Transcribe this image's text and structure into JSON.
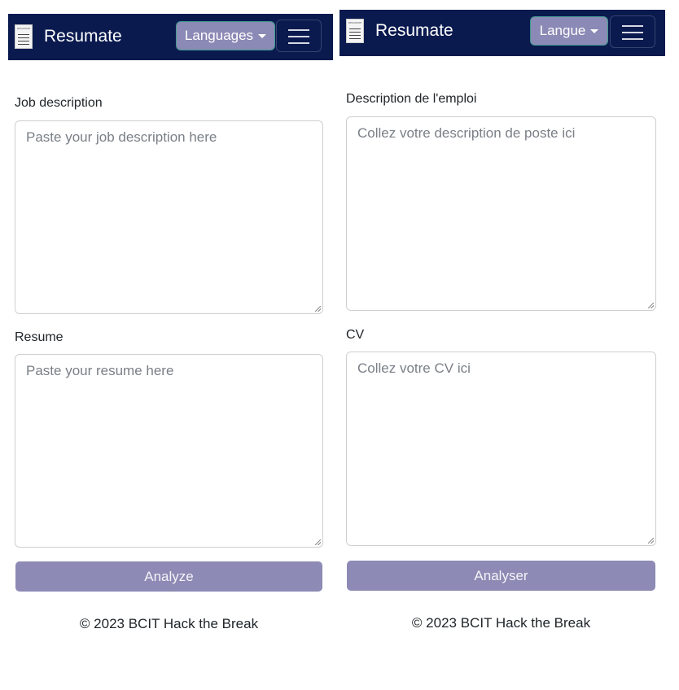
{
  "left": {
    "brand": "Resumate",
    "logo_text": "RESUMATE",
    "language_button": "Languages",
    "job_label": "Job description",
    "job_placeholder": "Paste your job description here",
    "resume_label": "Resume",
    "resume_placeholder": "Paste your resume here",
    "analyze_button": "Analyze",
    "footer": "© 2023 BCIT Hack the Break"
  },
  "right": {
    "brand": "Resumate",
    "logo_text": "RESUMATE",
    "language_button": "Langue",
    "job_label": "Description de l'emploi",
    "job_placeholder": "Collez votre description de poste ici",
    "resume_label": "CV",
    "resume_placeholder": "Collez votre CV ici",
    "analyze_button": "Analyser",
    "footer": "© 2023 BCIT Hack the Break"
  },
  "colors": {
    "navbar": "#0a1a4f",
    "language_button": "#8b89b5",
    "analyze_button": "#8d8ab5"
  }
}
